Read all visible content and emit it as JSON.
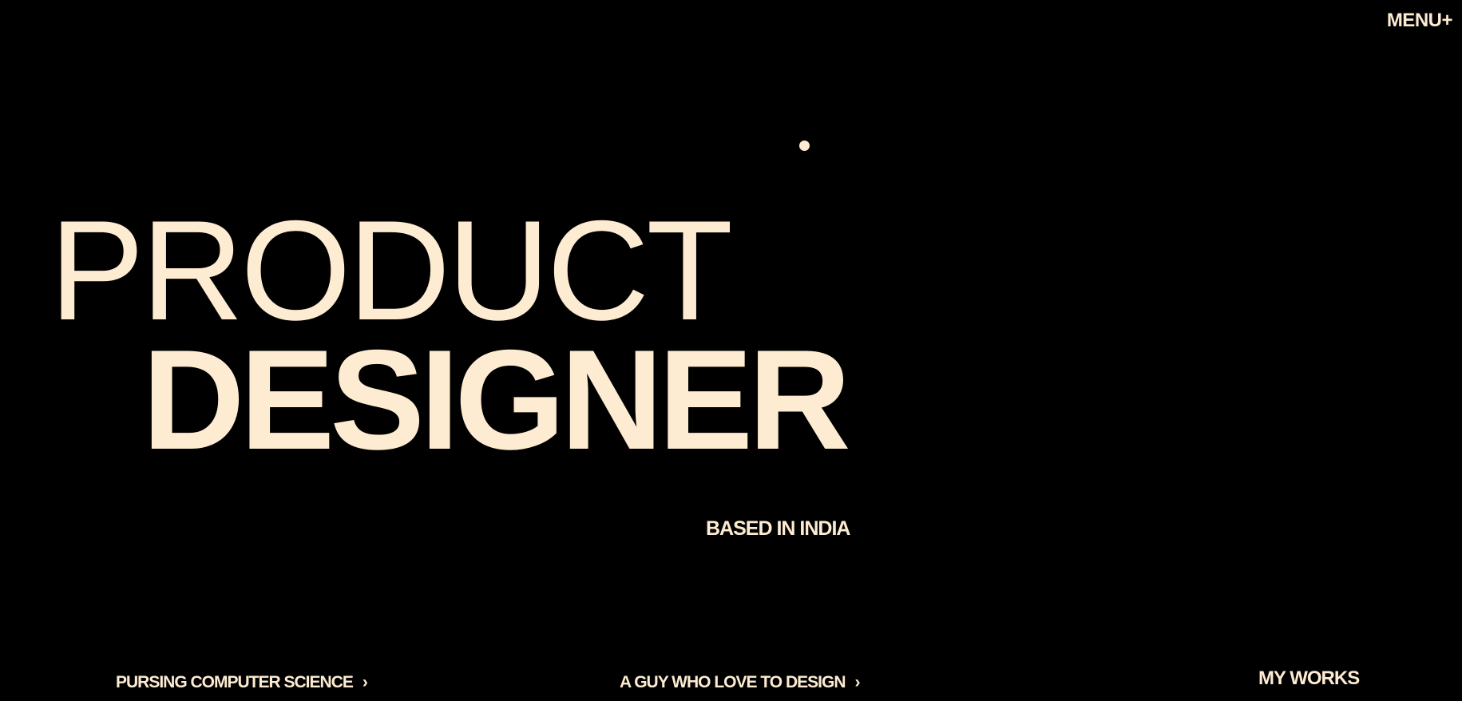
{
  "header": {
    "menu_label": "MENU+"
  },
  "hero": {
    "line1": "PRODUCT",
    "line2": "DESIGNER",
    "location": "BASED IN INDIA"
  },
  "footer": {
    "education_label": "PURSING COMPUTER SCIENCE",
    "about_label": "A GUY WHO LOVE TO DESIGN",
    "chevron": "›",
    "works_label": "MY WORKS"
  },
  "colors": {
    "background": "#000000",
    "text": "#fdecd2"
  },
  "icons": {
    "chevron": "chevron-right-icon",
    "cursor": "cursor-dot-icon"
  }
}
